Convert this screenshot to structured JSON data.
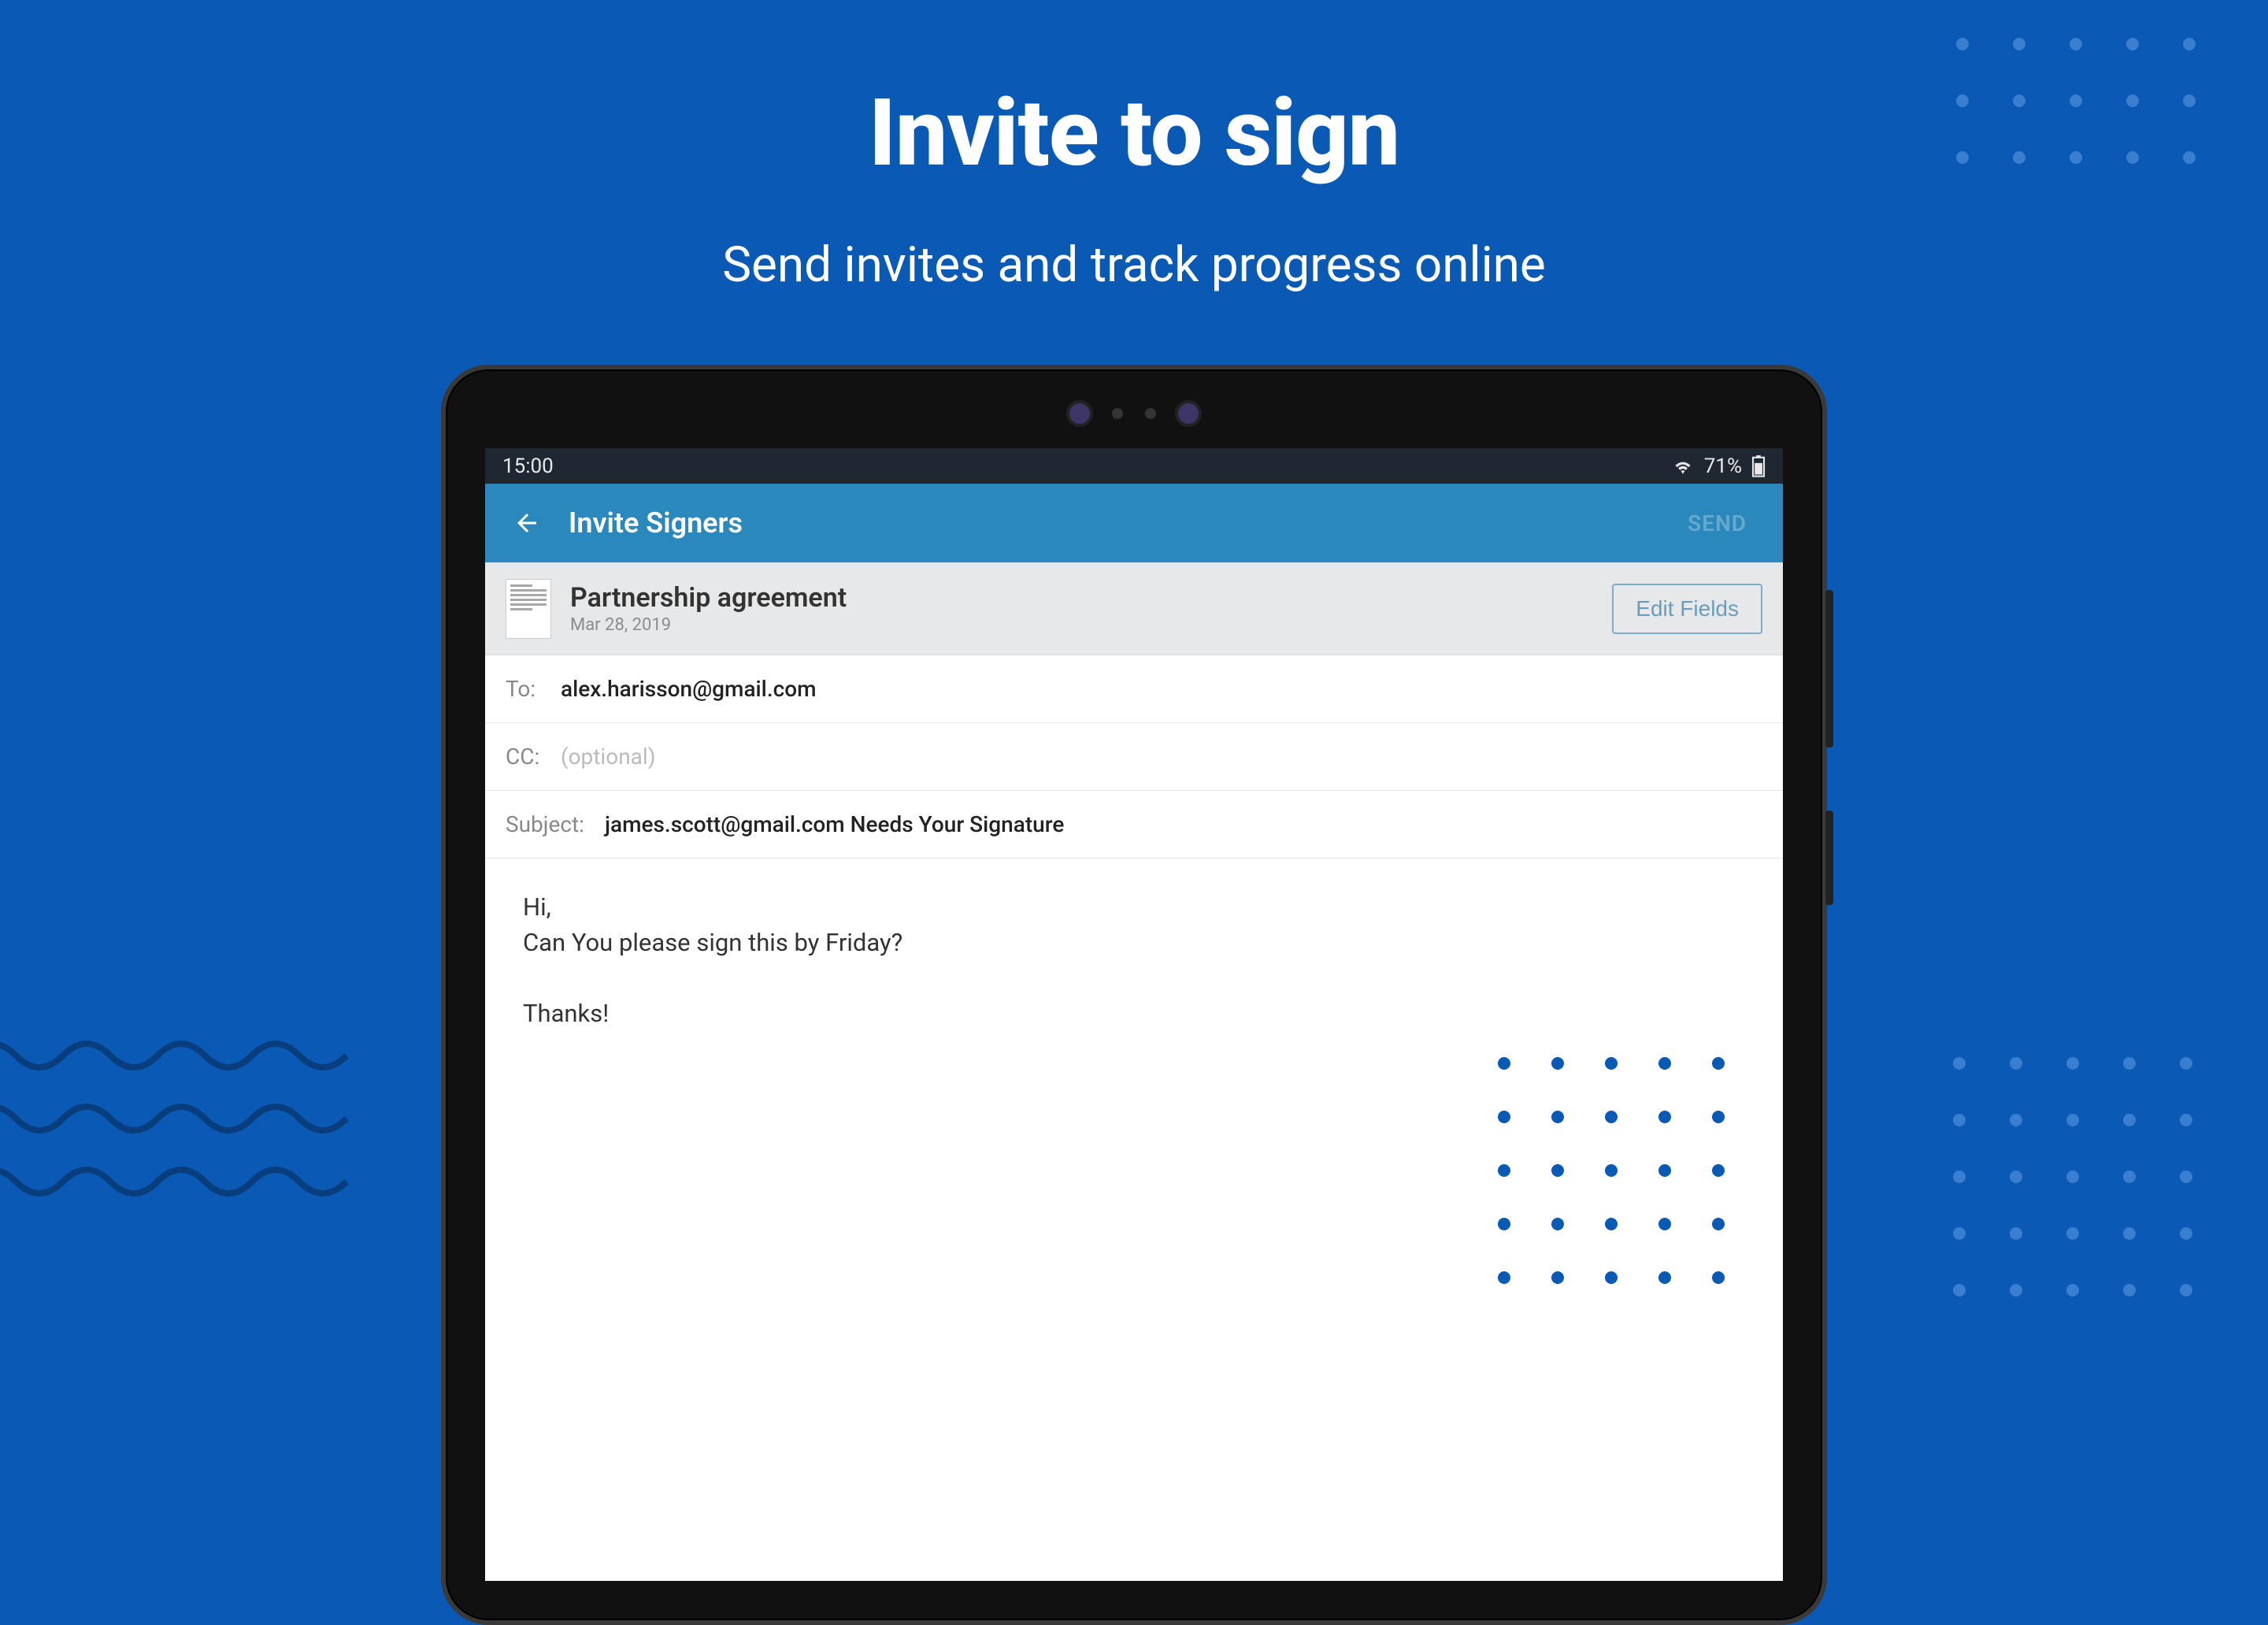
{
  "hero": {
    "title": "Invite to sign",
    "subtitle": "Send invites and track progress online"
  },
  "status_bar": {
    "time": "15:00",
    "battery_percent": "71%"
  },
  "app_header": {
    "title": "Invite Signers",
    "send_label": "SEND"
  },
  "document": {
    "title": "Partnership agreement",
    "date": "Mar 28, 2019",
    "edit_fields_label": "Edit Fields"
  },
  "form": {
    "to_label": "To:",
    "to_value": "alex.harisson@gmail.com",
    "cc_label": "CC:",
    "cc_placeholder": "(optional)",
    "subject_label": "Subject:",
    "subject_value": "james.scott@gmail.com Needs Your Signature",
    "message": "Hi,\nCan You please sign this by Friday?\n\nThanks!"
  }
}
